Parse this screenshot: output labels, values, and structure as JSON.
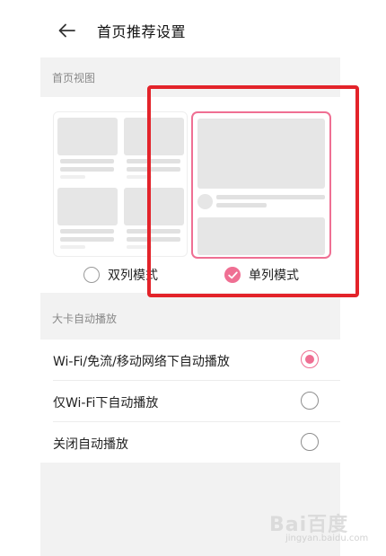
{
  "header": {
    "title": "首页推荐设置",
    "back_icon": "arrow-left-icon"
  },
  "home_view": {
    "section_label": "首页视图",
    "options": [
      {
        "label": "双列模式",
        "selected": false
      },
      {
        "label": "单列模式",
        "selected": true
      }
    ]
  },
  "autoplay": {
    "section_label": "大卡自动播放",
    "options": [
      {
        "label": "Wi-Fi/免流/移动网络下自动播放",
        "selected": true
      },
      {
        "label": "仅Wi-Fi下自动播放",
        "selected": false
      },
      {
        "label": "关闭自动播放",
        "selected": false
      }
    ]
  },
  "watermark": {
    "brand": "Bai百度",
    "sub": "jingyan.baidu.com"
  },
  "colors": {
    "accent": "#ef6f93",
    "highlight": "#e3232a",
    "background": "#f2f2f2"
  }
}
